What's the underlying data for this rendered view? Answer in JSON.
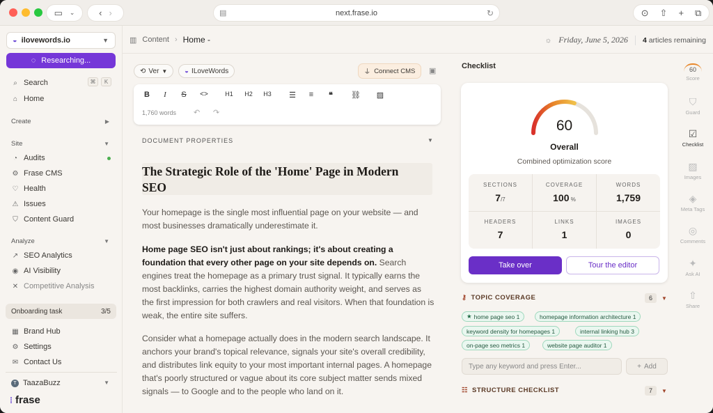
{
  "browser": {
    "url": "next.frase.io"
  },
  "sidebar": {
    "workspace": "ilovewords.io",
    "researching": "Researching...",
    "search": {
      "label": "Search",
      "kbd1": "⌘",
      "kbd2": "K"
    },
    "home": "Home",
    "create_label": "Create",
    "site_label": "Site",
    "site_items": [
      "Audits",
      "Frase CMS",
      "Health",
      "Issues",
      "Content Guard"
    ],
    "analyze_label": "Analyze",
    "analyze_items": [
      "SEO Analytics",
      "AI Visibility",
      "Competitive Analysis"
    ],
    "onboarding": {
      "label": "Onboarding task",
      "count": "3/5"
    },
    "bottom_items": [
      "Brand Hub",
      "Settings",
      "Contact Us"
    ],
    "team": "TaazaBuzz",
    "brand": "frase",
    "accent": "#7537d8"
  },
  "header": {
    "crumb_root": "Content",
    "crumb_current": "Home -",
    "date": "Friday, June 5, 2026",
    "articles_count": "4",
    "articles_label": "articles remaining"
  },
  "editor": {
    "ver_label": "Ver",
    "brand_chip": "ILoveWords",
    "connect_cms": "Connect CMS",
    "toolbar": {
      "h1": "H1",
      "h2": "H2",
      "h3": "H3"
    },
    "word_count": "1,760 words",
    "doc_props": "DOCUMENT PROPERTIES",
    "title": "The Strategic Role of the 'Home' Page in Modern SEO",
    "para1": "Your homepage is the single most influential page on your website — and most businesses dramatically underestimate it.",
    "para2_bold": "Home page SEO isn't just about rankings; it's about creating a foundation that every other page on your site depends on.",
    "para2_rest": " Search engines treat the homepage as a primary trust signal. It typically earns the most backlinks, carries the highest domain authority weight, and serves as the first impression for both crawlers and real visitors. When that foundation is weak, the entire site suffers.",
    "para3": "Consider what a homepage actually does in the modern search landscape. It anchors your brand's topical relevance, signals your site's overall credibility, and distributes link equity to your most important internal pages. A homepage that's poorly structured or vague about its core subject matter sends mixed signals — to Google and to the people who land on it."
  },
  "checklist": {
    "title": "Checklist",
    "score": "60",
    "score_value": 60,
    "overall": "Overall",
    "combined": "Combined optimization score",
    "stats": [
      {
        "label": "SECTIONS",
        "value": "7",
        "suffix": "/7"
      },
      {
        "label": "COVERAGE",
        "value": "100",
        "suffix": " %"
      },
      {
        "label": "WORDS",
        "value": "1,759",
        "suffix": ""
      },
      {
        "label": "HEADERS",
        "value": "7",
        "suffix": ""
      },
      {
        "label": "LINKS",
        "value": "1",
        "suffix": ""
      },
      {
        "label": "IMAGES",
        "value": "0",
        "suffix": ""
      }
    ],
    "take_over": "Take over",
    "tour": "Tour the editor",
    "topic_coverage": "TOPIC COVERAGE",
    "topic_count": "6",
    "keywords": [
      "home page seo 1",
      "homepage information architecture 1",
      "keyword density for homepages 1",
      "internal linking hub 3",
      "on-page seo metrics 1",
      "website page auditor 1"
    ],
    "kw_placeholder": "Type any keyword and press Enter...",
    "add": "Add",
    "structure": "STRUCTURE CHECKLIST",
    "structure_count": "7"
  },
  "rail": {
    "score": "60",
    "items": [
      "Score",
      "Guard",
      "Checklist",
      "Images",
      "Meta Tags",
      "Comments",
      "Ask AI",
      "Share"
    ]
  }
}
